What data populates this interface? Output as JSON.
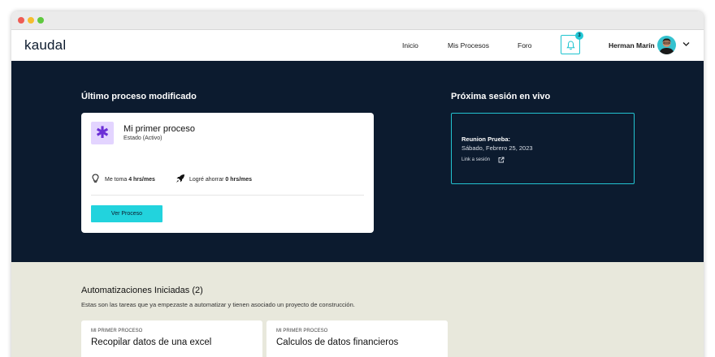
{
  "nav": {
    "logo": "kaudal",
    "links": [
      "Inicio",
      "Mis Procesos",
      "Foro"
    ],
    "notification_count": "3",
    "user_name": "Herman Marín"
  },
  "hero": {
    "last_process_heading": "Último proceso modificado",
    "process": {
      "title": "Mi primer proceso",
      "status": "Estado (Activo)",
      "time_label": "Me toma",
      "time_value": "4 hrs/mes",
      "saved_label": "Logré ahorrar",
      "saved_value": "0 hrs/mes",
      "button": "Ver Proceso"
    },
    "next_session_heading": "Próxima sesión en vivo",
    "session": {
      "title": "Reunion Prueba:",
      "date": "Sábado, Febrero 25, 2023",
      "link": "Link a sesión"
    }
  },
  "automations": {
    "heading": "Automatizaciones Iniciadas (2)",
    "description": "Estas son las tareas que ya empezaste a automatizar y tienen asociado un proyecto de construcción.",
    "cards": [
      {
        "kicker": "MI PRIMER PROCESO",
        "title": "Recopilar datos de una excel"
      },
      {
        "kicker": "MI PRIMER PROCESO",
        "title": "Calculos de datos financieros"
      }
    ]
  },
  "colors": {
    "navy": "#0c1b2f",
    "accent": "#22d3dd",
    "sand": "#e8e8dc",
    "icon_bg": "#e3d4ff"
  }
}
